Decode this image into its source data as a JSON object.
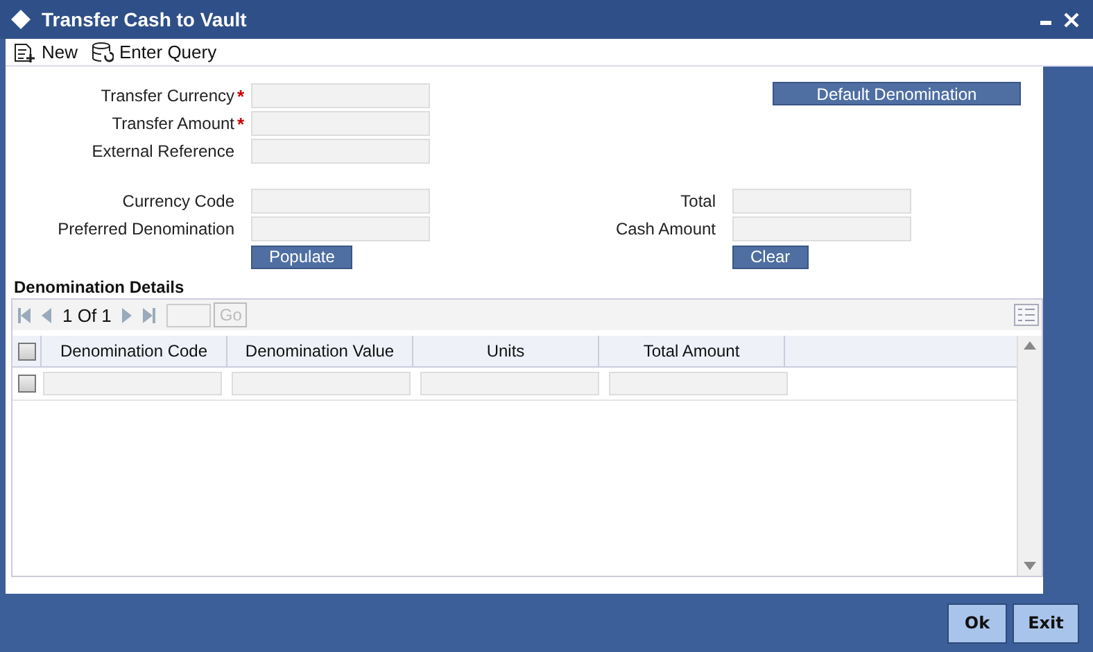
{
  "window": {
    "title": "Transfer Cash to Vault"
  },
  "toolbar": [
    {
      "kind": "new",
      "label": "New"
    },
    {
      "kind": "query",
      "label": "Enter Query"
    }
  ],
  "transfer_fields": [
    {
      "label": "Transfer Currency",
      "required_mark": "*"
    },
    {
      "label": "Transfer Amount",
      "required_mark": "*"
    },
    {
      "label": "External Reference"
    }
  ],
  "default_button": "Default Denomination",
  "left_fields": [
    {
      "label": "Currency Code"
    },
    {
      "label": "Preferred Denomination"
    }
  ],
  "populate_button": "Populate",
  "right_fields": [
    {
      "label": "Total"
    },
    {
      "label": "Cash Amount"
    }
  ],
  "clear_button": "Clear",
  "section": {
    "title": "Denomination Details"
  },
  "pager": {
    "text": "1 Of 1",
    "go": "Go",
    "go_disabled": true
  },
  "table": {
    "header_checked": false,
    "columns": [
      "Denomination Code",
      "Denomination Value",
      "Units",
      "Total Amount"
    ],
    "rows": [
      {
        "checked": false
      }
    ]
  },
  "footer_buttons": [
    "Ok",
    "Exit"
  ]
}
